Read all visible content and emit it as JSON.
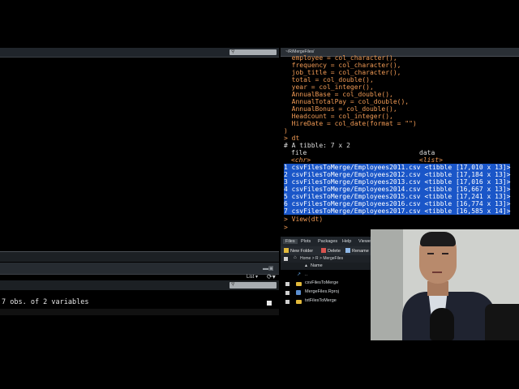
{
  "left": {
    "env_object_summary": "7 obs. of 2 variables",
    "list_toggle": "List"
  },
  "console": {
    "path": "~/R/MergeFiles/",
    "code_lines": [
      "  employee = col_character(),",
      "  frequency = col_character(),",
      "  job_title = col_character(),",
      "  total = col_double(),",
      "  year = col_integer(),",
      "  AnnualBase = col_double(),",
      "  AnnualTotalPay = col_double(),",
      "  AnnualBonus = col_double(),",
      "  Headcount = col_integer(),",
      "  HireDate = col_date(format = \"\")",
      ")"
    ],
    "cmd_dt": "> dt",
    "tibble_header": "# A tibble: 7 x 2",
    "col_headers": {
      "file": "file",
      "data": "data"
    },
    "col_types": {
      "file": "<chr>",
      "data": "<list>"
    },
    "rows": [
      {
        "n": "1",
        "file": "csvFilesToMerge/Employees2011.csv",
        "data": "<tibble [17,010 x 13]>"
      },
      {
        "n": "2",
        "file": "csvFilesToMerge/Employees2012.csv",
        "data": "<tibble [17,184 x 13]>"
      },
      {
        "n": "3",
        "file": "csvFilesToMerge/Employees2013.csv",
        "data": "<tibble [17,016 x 13]>"
      },
      {
        "n": "4",
        "file": "csvFilesToMerge/Employees2014.csv",
        "data": "<tibble [16,667 x 13]>"
      },
      {
        "n": "5",
        "file": "csvFilesToMerge/Employees2015.csv",
        "data": "<tibble [17,241 x 13]>"
      },
      {
        "n": "6",
        "file": "csvFilesToMerge/Employees2016.csv",
        "data": "<tibble [16,774 x 13]>"
      },
      {
        "n": "7",
        "file": "csvFilesToMerge/Employees2017.csv",
        "data": "<tibble [16,585 x 14]>"
      }
    ],
    "cmd_view": "> View(dt)",
    "prompt": ">"
  },
  "files": {
    "tabs": [
      "Files",
      "Plots",
      "Packages",
      "Help",
      "Viewer"
    ],
    "toolbar": {
      "new_folder": "New Folder",
      "delete": "Delete",
      "rename": "Rename"
    },
    "breadcrumb": "Home > R > MergeFiles",
    "name_col": "Name",
    "up_label": "..",
    "items": [
      "csvFilesToMerge",
      "MergeFiles.Rproj",
      "txtFilesToMerge"
    ]
  },
  "colors": {
    "selection": "#1a56c8",
    "code_orange": "#f09a55",
    "folder_yellow": "#e2b93b"
  }
}
